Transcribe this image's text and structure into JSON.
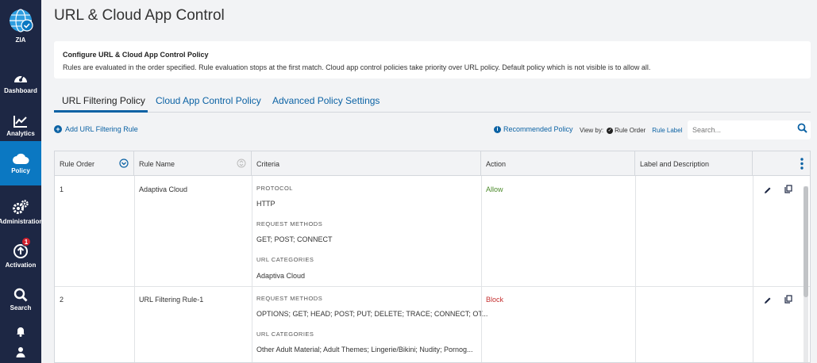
{
  "sidebar": {
    "logo_label": "ZIA",
    "items": [
      {
        "label": "Dashboard"
      },
      {
        "label": "Analytics"
      },
      {
        "label": "Policy"
      },
      {
        "label": "Administration"
      },
      {
        "label": "Activation",
        "badge": "1"
      },
      {
        "label": "Search"
      }
    ]
  },
  "page": {
    "title": "URL & Cloud App Control"
  },
  "info": {
    "heading": "Configure URL & Cloud App Control Policy",
    "description": "Rules are evaluated in the order specified. Rule evaluation stops at the first match. Cloud app control policies take priority over URL policy. Default policy which is not visible is to allow all."
  },
  "tabs": [
    {
      "label": "URL Filtering Policy"
    },
    {
      "label": "Cloud App Control Policy"
    },
    {
      "label": "Advanced Policy Settings"
    }
  ],
  "toolbar": {
    "add_rule": "Add URL Filtering Rule",
    "recommended": "Recommended Policy",
    "view_by": "View by:",
    "rule_order": "Rule Order",
    "rule_label": "Rule Label",
    "search_placeholder": "Search..."
  },
  "table": {
    "headers": [
      "Rule Order",
      "Rule Name",
      "Criteria",
      "Action",
      "Label and Description"
    ],
    "rows": [
      {
        "order": "1",
        "name": "Adaptiva Cloud",
        "criteria": [
          {
            "label": "PROTOCOL",
            "value": "HTTP"
          },
          {
            "label": "REQUEST METHODS",
            "value": "GET; POST; CONNECT"
          },
          {
            "label": "URL CATEGORIES",
            "value": "Adaptiva Cloud"
          }
        ],
        "action": "Allow"
      },
      {
        "order": "2",
        "name": "URL Filtering Rule-1",
        "criteria": [
          {
            "label": "REQUEST METHODS",
            "value": "OPTIONS; GET; HEAD; POST; PUT; DELETE; TRACE; CONNECT; OT..."
          },
          {
            "label": "URL CATEGORIES",
            "value": "Other Adult Material; Adult Themes; Lingerie/Bikini; Nudity; Pornog..."
          }
        ],
        "action": "Block"
      }
    ]
  },
  "colors": {
    "sidebar": "#1d2744",
    "active_nav": "#0b78c2",
    "link": "#0b62a4",
    "allow": "#4c8a2b",
    "block": "#c53030"
  }
}
